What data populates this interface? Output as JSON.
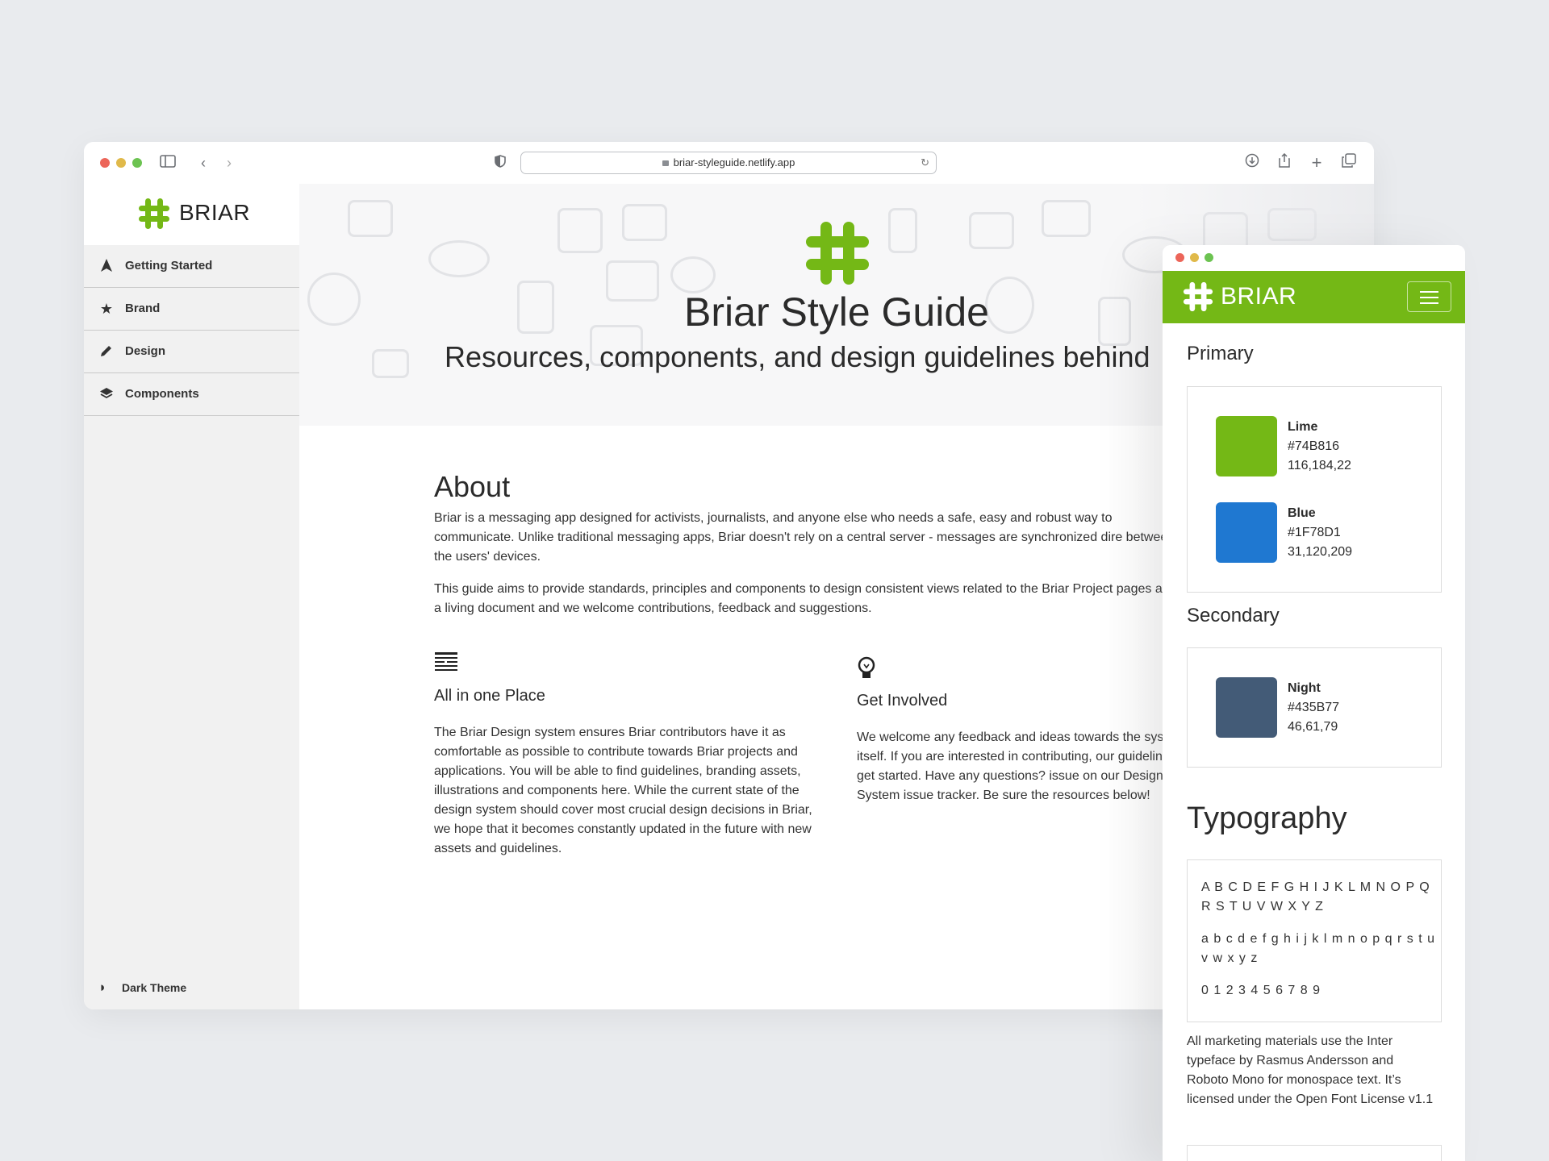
{
  "browser": {
    "url": "briar-styleguide.netlify.app"
  },
  "brand": {
    "name": "BRIAR",
    "accent": "#74B816",
    "blue": "#1F78D1",
    "night": "#435B77"
  },
  "sidebar": {
    "items": [
      {
        "label": "Getting Started",
        "icon": "navigation-arrow-icon"
      },
      {
        "label": "Brand",
        "icon": "star-icon"
      },
      {
        "label": "Design",
        "icon": "pencil-icon"
      },
      {
        "label": "Components",
        "icon": "layers-icon"
      }
    ],
    "theme_toggle": "Dark Theme"
  },
  "hero": {
    "title": "Briar Style Guide",
    "subtitle": "Resources, components, and design guidelines behind"
  },
  "about": {
    "heading": "About",
    "p1": "Briar is a messaging app designed for activists, journalists, and anyone else who needs a safe, easy and robust way to communicate. Unlike traditional messaging apps, Briar doesn't rely on a central server - messages are synchronized dire between the users' devices.",
    "p2": "This guide aims to provide standards, principles and components to design consistent views related to the Briar Project pages are a living document and we welcome contributions, feedback and suggestions."
  },
  "features": [
    {
      "title": "All in one Place",
      "icon": "document-lines-icon",
      "text": "The Briar Design system ensures Briar contributors have it as comfortable as possible to contribute towards Briar projects and applications. You will be able to find guidelines, branding assets, illustrations and components here. While the current state of the design system should cover most crucial design decisions in Briar, we hope that it becomes constantly updated in the future with new assets and guidelines."
    },
    {
      "title": "Get Involved",
      "icon": "lightbulb-icon",
      "text": "We welcome any feedback and ideas towards the system itself. If you are interested in contributing, our guidelines to get started. Have any questions? issue on our Design System issue tracker. Be sure the resources below!"
    }
  ],
  "mobile": {
    "primary_heading": "Primary",
    "secondary_heading": "Secondary",
    "colors_primary": [
      {
        "name": "Lime",
        "hex": "#74B816",
        "rgb": "116,184,22"
      },
      {
        "name": "Blue",
        "hex": "#1F78D1",
        "rgb": "31,120,209"
      }
    ],
    "colors_secondary": [
      {
        "name": "Night",
        "hex": "#435B77",
        "rgb": "46,61,79"
      }
    ],
    "typography_heading": "Typography",
    "upper": "A B C D E F G H I J K L M N O P Q R S T U V W X Y Z",
    "lower": "a b c d e f g h i j k l m n o p q r s t u v w x y z",
    "digits": "0 1 2 3 4 5 6 7 8 9",
    "typography_note": "All marketing materials use the Inter typeface by Rasmus Andersson and Roboto Mono for monospace text. It’s licensed under the Open Font License v1.1"
  }
}
